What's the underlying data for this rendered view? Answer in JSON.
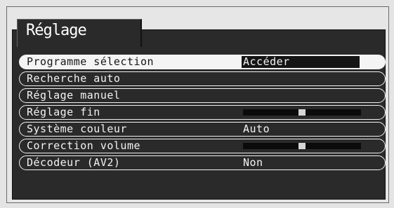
{
  "menu": {
    "title": "Réglage",
    "items": [
      {
        "label": "Programme sélection",
        "value": "Accéder",
        "selected": true
      },
      {
        "label": "Recherche auto"
      },
      {
        "label": "Réglage manuel"
      },
      {
        "label": "Réglage fin",
        "slider_level": 0.5
      },
      {
        "label": "Système couleur",
        "value": "Auto"
      },
      {
        "label": "Correction volume",
        "slider_level": 0.5
      },
      {
        "label": "Décodeur (AV2)",
        "value": "Non"
      }
    ]
  },
  "colors": {
    "panel": "#2a2a2a",
    "text": "#f4f4f4",
    "selected_background": "#f4f4f4",
    "selected_text": "#151515",
    "slider_track": "#0b0b0b",
    "slider_knob": "#d6d6d6"
  }
}
